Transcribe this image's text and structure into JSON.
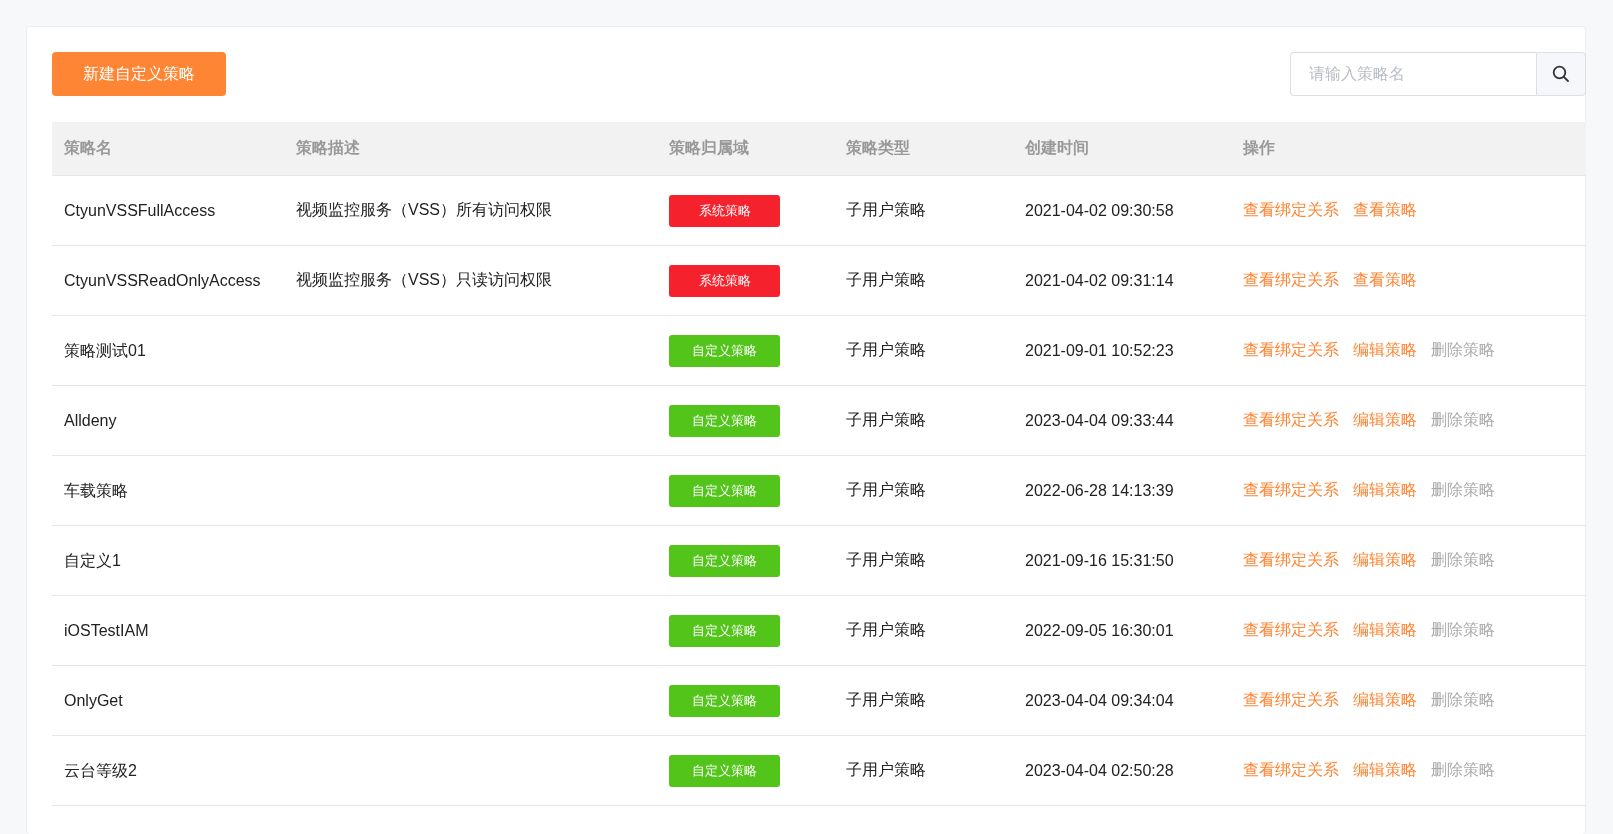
{
  "toolbar": {
    "create_button": "新建自定义策略",
    "search": {
      "placeholder": "请输入策略名"
    }
  },
  "table": {
    "columns": [
      "策略名",
      "策略描述",
      "策略归属域",
      "策略类型",
      "创建时间",
      "操作"
    ],
    "rows": [
      {
        "name": "CtyunVSSFullAccess",
        "description": "视频监控服务（VSS）所有访问权限",
        "domain": {
          "kind": "system",
          "label": "系统策略"
        },
        "type": "子用户策略",
        "created": "2021-04-02 09:30:58",
        "actions": [
          {
            "label": "查看绑定关系",
            "disabled": false
          },
          {
            "label": "查看策略",
            "disabled": false
          }
        ]
      },
      {
        "name": "CtyunVSSReadOnlyAccess",
        "description": "视频监控服务（VSS）只读访问权限",
        "domain": {
          "kind": "system",
          "label": "系统策略"
        },
        "type": "子用户策略",
        "created": "2021-04-02 09:31:14",
        "actions": [
          {
            "label": "查看绑定关系",
            "disabled": false
          },
          {
            "label": "查看策略",
            "disabled": false
          }
        ]
      },
      {
        "name": "策略测试01",
        "description": "",
        "domain": {
          "kind": "custom",
          "label": "自定义策略"
        },
        "type": "子用户策略",
        "created": "2021-09-01 10:52:23",
        "actions": [
          {
            "label": "查看绑定关系",
            "disabled": false
          },
          {
            "label": "编辑策略",
            "disabled": false
          },
          {
            "label": "删除策略",
            "disabled": true
          }
        ]
      },
      {
        "name": "Alldeny",
        "description": "",
        "domain": {
          "kind": "custom",
          "label": "自定义策略"
        },
        "type": "子用户策略",
        "created": "2023-04-04 09:33:44",
        "actions": [
          {
            "label": "查看绑定关系",
            "disabled": false
          },
          {
            "label": "编辑策略",
            "disabled": false
          },
          {
            "label": "删除策略",
            "disabled": true
          }
        ]
      },
      {
        "name": "车载策略",
        "description": "",
        "domain": {
          "kind": "custom",
          "label": "自定义策略"
        },
        "type": "子用户策略",
        "created": "2022-06-28 14:13:39",
        "actions": [
          {
            "label": "查看绑定关系",
            "disabled": false
          },
          {
            "label": "编辑策略",
            "disabled": false
          },
          {
            "label": "删除策略",
            "disabled": true
          }
        ]
      },
      {
        "name": "自定义1",
        "description": "",
        "domain": {
          "kind": "custom",
          "label": "自定义策略"
        },
        "type": "子用户策略",
        "created": "2021-09-16 15:31:50",
        "actions": [
          {
            "label": "查看绑定关系",
            "disabled": false
          },
          {
            "label": "编辑策略",
            "disabled": false
          },
          {
            "label": "删除策略",
            "disabled": true
          }
        ]
      },
      {
        "name": "iOSTestIAM",
        "description": "",
        "domain": {
          "kind": "custom",
          "label": "自定义策略"
        },
        "type": "子用户策略",
        "created": "2022-09-05 16:30:01",
        "actions": [
          {
            "label": "查看绑定关系",
            "disabled": false
          },
          {
            "label": "编辑策略",
            "disabled": false
          },
          {
            "label": "删除策略",
            "disabled": true
          }
        ]
      },
      {
        "name": "OnlyGet",
        "description": "",
        "domain": {
          "kind": "custom",
          "label": "自定义策略"
        },
        "type": "子用户策略",
        "created": "2023-04-04 09:34:04",
        "actions": [
          {
            "label": "查看绑定关系",
            "disabled": false
          },
          {
            "label": "编辑策略",
            "disabled": false
          },
          {
            "label": "删除策略",
            "disabled": true
          }
        ]
      },
      {
        "name": "云台等级2",
        "description": "",
        "domain": {
          "kind": "custom",
          "label": "自定义策略"
        },
        "type": "子用户策略",
        "created": "2023-04-04 02:50:28",
        "actions": [
          {
            "label": "查看绑定关系",
            "disabled": false
          },
          {
            "label": "编辑策略",
            "disabled": false
          },
          {
            "label": "删除策略",
            "disabled": true
          }
        ]
      }
    ]
  }
}
